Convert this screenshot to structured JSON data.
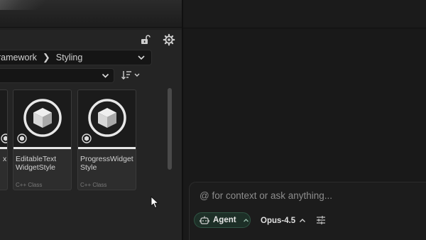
{
  "content_browser": {
    "path": [
      "ramework",
      "Styling"
    ],
    "assets": [
      {
        "name": "x",
        "type": ""
      },
      {
        "name": "EditableText WidgetStyle",
        "type": "C++ Class"
      },
      {
        "name": "ProgressWidget Style",
        "type": "C++ Class"
      }
    ]
  },
  "composer": {
    "placeholder": "@ for context or ask anything...",
    "mode_label": "Agent",
    "model_label": "Opus-4.5"
  },
  "icons": {
    "lock": "unlock-icon",
    "settings": "gear-icon",
    "path_dropdown": "chevron-down-icon",
    "filter_dropdown": "chevron-down-icon",
    "sort": "sort-icon",
    "asset_thumbnail": "cube-icon",
    "asset_badge": "cpp-class-badge-icon",
    "agent": "robot-icon",
    "tune": "sliders-icon",
    "cursor": "mouse-pointer-icon"
  },
  "colors": {
    "accent_green": "#2f5443",
    "agent_chip_bg": "#1d2f27",
    "tile_bg": "#2d2d2d",
    "panel_bg": "#191919"
  }
}
